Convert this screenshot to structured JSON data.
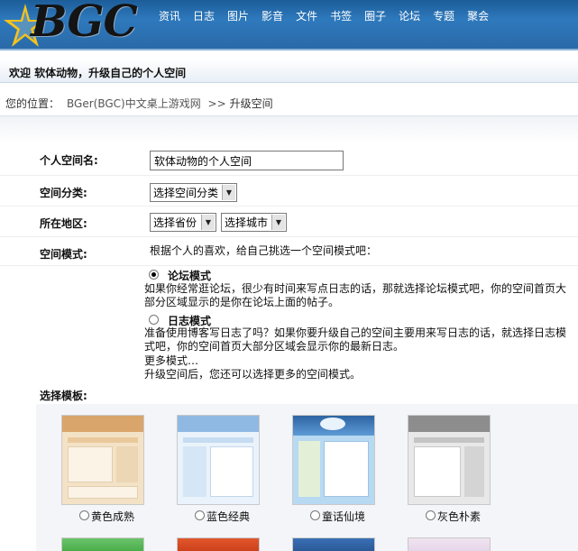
{
  "header": {
    "logo_text": "BGC",
    "nav": [
      "资讯",
      "日志",
      "图片",
      "影音",
      "文件",
      "书签",
      "圈子",
      "论坛",
      "专题",
      "聚会"
    ]
  },
  "welcome": {
    "text": "欢迎 软体动物，升级自己的个人空间"
  },
  "breadcrumb": {
    "prefix": "您的位置：",
    "site": "BGer(BGC)中文桌上游戏网",
    "separator": ">>",
    "current": "升级空间"
  },
  "form": {
    "space_name": {
      "label": "个人空间名:",
      "value": "软体动物的个人空间"
    },
    "category": {
      "label": "空间分类:",
      "selected": "选择空间分类"
    },
    "region": {
      "label": "所在地区:",
      "province": "选择省份",
      "city": "选择城市"
    },
    "mode": {
      "label": "空间模式:",
      "intro": "根据个人的喜欢，给自己挑选一个空间模式吧：",
      "options": [
        {
          "title": "论坛模式",
          "checked": true,
          "desc_line1": "如果你经常逛论坛，很少有时间来写点日志的话，那就选择论坛模式吧，你的空间首页大",
          "desc_line2": "部分区域显示的是你在论坛上面的帖子。"
        },
        {
          "title": "日志模式",
          "checked": false,
          "desc_line1": "准备使用博客写日志了吗？如果你要升级自己的空间主要用来写日志的话，就选择日志模",
          "desc_line2": "式吧，你的空间首页大部分区域会显示你的最新日志。"
        }
      ],
      "more_title": "更多模式…",
      "more_desc": "升级空间后，您还可以选择更多的空间模式。"
    },
    "templates": {
      "label": "选择模板:",
      "items": [
        {
          "name": "黄色成熟",
          "color": "#d9a56a"
        },
        {
          "name": "蓝色经典",
          "color": "#8fb9e2"
        },
        {
          "name": "童话仙境",
          "color": "#3b78b8"
        },
        {
          "name": "灰色朴素",
          "color": "#8d8d8d"
        }
      ]
    }
  }
}
